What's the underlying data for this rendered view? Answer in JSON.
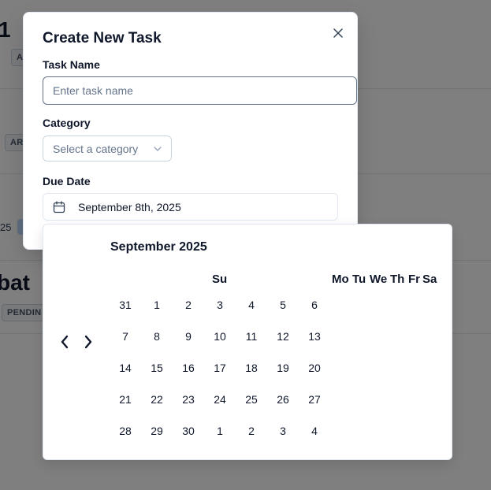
{
  "background": {
    "partial_digit": "1",
    "chip_1": "AR",
    "chip_2": "AR",
    "partial_text_25": "25",
    "partial_word": "bat",
    "chip_pending": "PENDIN"
  },
  "modal": {
    "title": "Create New Task",
    "task_name_label": "Task Name",
    "task_name_placeholder": "Enter task name",
    "category_label": "Category",
    "category_placeholder": "Select a category",
    "due_date_label": "Due Date",
    "due_date_value": "September 8th, 2025",
    "close_icon": "close-icon"
  },
  "calendar": {
    "caption": "September 2025",
    "prev_icon": "chevron-left-icon",
    "next_icon": "chevron-right-icon",
    "weekdays": [
      "Su",
      "Mo",
      "Tu",
      "We",
      "Th",
      "Fr",
      "Sa"
    ],
    "weeks": [
      [
        "31",
        "1",
        "2",
        "3",
        "4",
        "5",
        "6"
      ],
      [
        "7",
        "8",
        "9",
        "10",
        "11",
        "12",
        "13"
      ],
      [
        "14",
        "15",
        "16",
        "17",
        "18",
        "19",
        "20"
      ],
      [
        "21",
        "22",
        "23",
        "24",
        "25",
        "26",
        "27"
      ],
      [
        "28",
        "29",
        "30",
        "1",
        "2",
        "3",
        "4"
      ]
    ]
  },
  "colors": {
    "overlay": "#000000",
    "text": "#0f172a",
    "muted": "#64748b",
    "border": "#e2e8f0"
  }
}
